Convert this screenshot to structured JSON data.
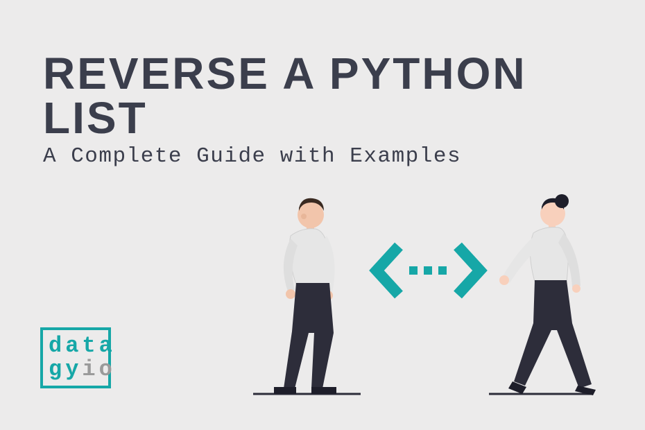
{
  "title": "Reverse a Python List",
  "subtitle": "A Complete Guide with Examples",
  "logo": {
    "line1_a": "data",
    "line2_a": "gy",
    "line2_b": "io"
  },
  "colors": {
    "background": "#ecebeb",
    "text": "#3b3e4c",
    "accent": "#16a7a7",
    "muted": "#9a9a9a",
    "skin1": "#f2c5ab",
    "skin2": "#f8d0bc",
    "hair1": "#3a2a21",
    "hair2": "#1e1e2a",
    "shirt": "#e6e6e6",
    "pants": "#2d2d3a"
  }
}
